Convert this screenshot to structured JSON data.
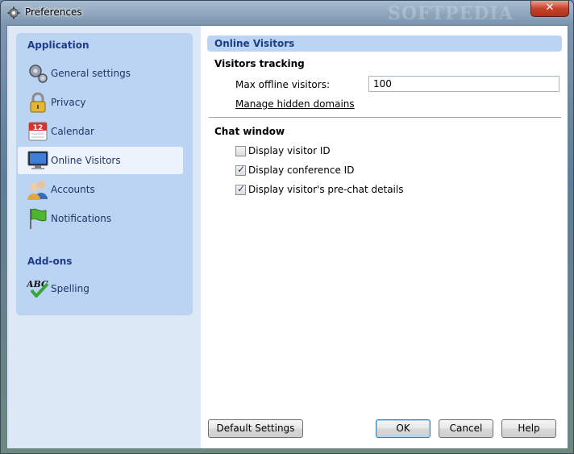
{
  "window": {
    "title": "Preferences",
    "watermark": "SOFTPEDIA",
    "close_glyph": "✕"
  },
  "sidebar": {
    "groups": [
      {
        "header": "Application",
        "items": [
          {
            "label": "General settings",
            "icon": "gears-icon"
          },
          {
            "label": "Privacy",
            "icon": "padlock-icon"
          },
          {
            "label": "Calendar",
            "icon": "calendar-icon",
            "icon_text": "12"
          },
          {
            "label": "Online Visitors",
            "icon": "monitor-icon",
            "selected": true
          },
          {
            "label": "Accounts",
            "icon": "users-icon"
          },
          {
            "label": "Notifications",
            "icon": "green-flag-icon"
          }
        ]
      },
      {
        "header": "Add-ons",
        "items": [
          {
            "label": "Spelling",
            "icon": "abc-check-icon",
            "icon_text": "ABC"
          }
        ]
      }
    ]
  },
  "panel": {
    "title": "Online Visitors",
    "visitors_tracking": {
      "title": "Visitors tracking",
      "max_offline_label": "Max offline visitors:",
      "max_offline_value": "100",
      "manage_link": "Manage hidden domains"
    },
    "chat_window": {
      "title": "Chat window",
      "options": [
        {
          "label": "Display visitor ID",
          "checked": false
        },
        {
          "label": "Display conference ID",
          "checked": true
        },
        {
          "label": "Display visitor's pre-chat details",
          "checked": true
        }
      ]
    }
  },
  "buttons": {
    "default_settings": "Default Settings",
    "ok": "OK",
    "cancel": "Cancel",
    "help": "Help"
  },
  "colors": {
    "accent_text": "#1d3c8a",
    "sidebar_bg": "#bcd4f3",
    "close_red": "#c7432c"
  }
}
